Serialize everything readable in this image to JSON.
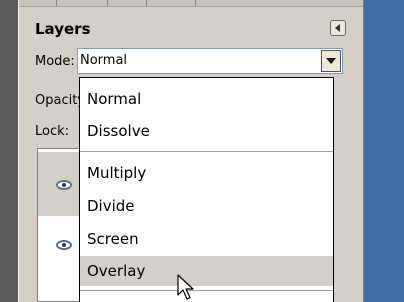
{
  "panel": {
    "title": "Layers",
    "collapse_icon": "collapse-left-icon"
  },
  "mode": {
    "label": "Mode:",
    "value": "Normal"
  },
  "opacity": {
    "label": "Opacity:"
  },
  "lock": {
    "label": "Lock:"
  },
  "dropdown": {
    "options": [
      "Normal",
      "Dissolve",
      "Multiply",
      "Divide",
      "Screen",
      "Overlay"
    ],
    "highlighted": "Overlay"
  },
  "colors": {
    "panel_bg": "#d4d0c8",
    "desktop_bg": "#3f6ea8",
    "highlight": "#d4d0c8"
  }
}
